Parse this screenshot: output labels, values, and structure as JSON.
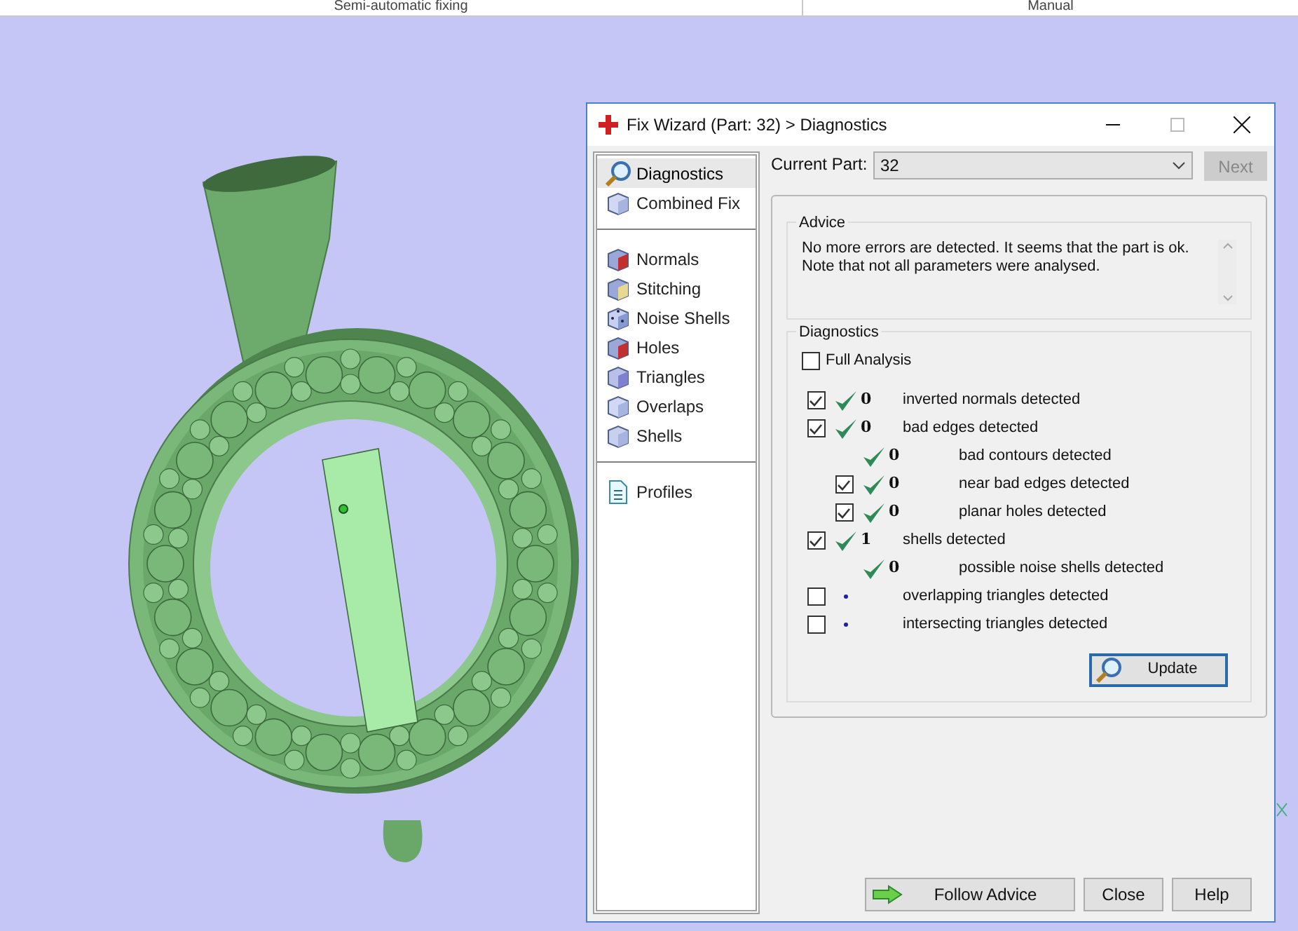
{
  "top_tabs": [
    {
      "label": "Semi-automatic fixing"
    },
    {
      "label": "Manual"
    }
  ],
  "window": {
    "title": "Fix Wizard (Part: 32) > Diagnostics"
  },
  "sidebar": {
    "groups": [
      [
        {
          "label": "Diagnostics",
          "selected": true
        },
        {
          "label": "Combined Fix",
          "selected": false
        }
      ],
      [
        {
          "label": "Normals",
          "selected": false
        },
        {
          "label": "Stitching",
          "selected": false
        },
        {
          "label": "Noise Shells",
          "selected": false
        },
        {
          "label": "Holes",
          "selected": false
        },
        {
          "label": "Triangles",
          "selected": false
        },
        {
          "label": "Overlaps",
          "selected": false
        },
        {
          "label": "Shells",
          "selected": false
        }
      ],
      [
        {
          "label": "Profiles",
          "selected": false
        }
      ]
    ]
  },
  "current_part": {
    "label": "Current Part:",
    "value": "32",
    "next_button": "Next"
  },
  "advice": {
    "title": "Advice",
    "text": "No more errors are detected. It seems that the part is ok.\nNote that not all parameters were analysed."
  },
  "diagnostics": {
    "title": "Diagnostics",
    "full_analysis": {
      "label": "Full Analysis",
      "checked": false
    },
    "rows": [
      {
        "kind": "checkable",
        "checked": true,
        "analysed": true,
        "count": "0",
        "label": "inverted normals detected"
      },
      {
        "kind": "checkable",
        "checked": true,
        "analysed": true,
        "count": "0",
        "label": "bad edges detected",
        "children": [
          {
            "kind": "info",
            "analysed": true,
            "count": "0",
            "label": "bad contours detected"
          },
          {
            "kind": "checkable",
            "checked": true,
            "analysed": true,
            "count": "0",
            "label": "near bad edges detected"
          },
          {
            "kind": "checkable",
            "checked": true,
            "analysed": true,
            "count": "0",
            "label": "planar holes detected"
          }
        ]
      },
      {
        "kind": "checkable",
        "checked": true,
        "analysed": true,
        "count": "1",
        "label": "shells detected",
        "children": [
          {
            "kind": "info",
            "analysed": true,
            "count": "0",
            "label": "possible noise shells detected"
          }
        ]
      },
      {
        "kind": "checkable",
        "checked": false,
        "analysed": false,
        "label": "overlapping triangles detected"
      },
      {
        "kind": "checkable",
        "checked": false,
        "analysed": false,
        "label": "intersecting triangles detected"
      }
    ],
    "update_button": "Update"
  },
  "footer_buttons": [
    {
      "label": "Follow Advice"
    },
    {
      "label": "Close"
    },
    {
      "label": "Help"
    }
  ]
}
